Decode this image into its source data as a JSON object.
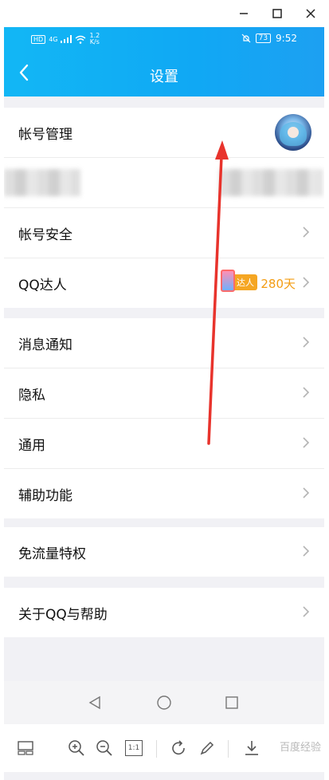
{
  "window": {
    "minimize": "—",
    "maximize": "☐",
    "close": "✕"
  },
  "status_bar": {
    "hd": "HD",
    "network": "4G",
    "speed_value": "1.2",
    "speed_unit": "K/s",
    "battery": "73",
    "time": "9:52"
  },
  "header": {
    "title": "设置"
  },
  "groups": {
    "account": {
      "account_management": "帐号管理",
      "account_security": "帐号安全",
      "qq_expert": "QQ达人",
      "qq_badge": "达人",
      "qq_days": "280天"
    },
    "settings": {
      "notifications": "消息通知",
      "privacy": "隐私",
      "general": "通用",
      "accessibility": "辅助功能"
    },
    "data": {
      "free_data": "免流量特权"
    },
    "about": {
      "about_help": "关于QQ与帮助"
    }
  },
  "toolbar": {
    "zoom_reset": "1:1",
    "watermark": "百度经验"
  },
  "colors": {
    "header_blue": "#12b7f5",
    "accent_orange": "#f39c12",
    "arrow_red": "#e8332c"
  }
}
